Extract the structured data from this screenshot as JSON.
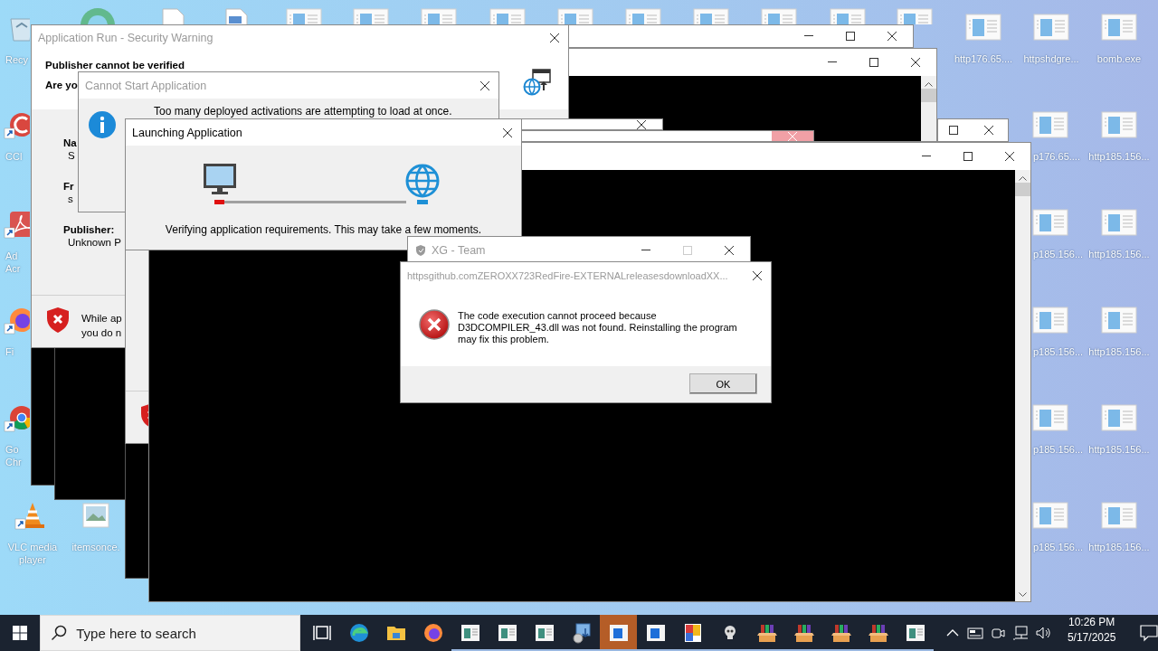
{
  "covered_icons": [
    {
      "kind": "app-round"
    },
    {
      "kind": "document"
    },
    {
      "kind": "document-blue"
    },
    {
      "kind": "window-file"
    },
    {
      "kind": "window-file"
    },
    {
      "kind": "window-file"
    },
    {
      "kind": "window-file"
    },
    {
      "kind": "window-file"
    },
    {
      "kind": "window-file"
    },
    {
      "kind": "window-file"
    },
    {
      "kind": "window-file"
    },
    {
      "kind": "window-file"
    },
    {
      "kind": "window-file"
    }
  ],
  "desktop_icons": [
    {
      "kind": "recycle-bin",
      "shortcut": false,
      "label": "Recy"
    },
    {
      "kind": "cleaner",
      "shortcut": true,
      "label": "CCl"
    },
    {
      "kind": "pdf-reader",
      "shortcut": true,
      "label": "Ad\nAcr"
    },
    {
      "kind": "firefox",
      "shortcut": true,
      "label": "Fi"
    },
    {
      "kind": "chrome",
      "shortcut": true,
      "label": "Go\nChr"
    },
    {
      "kind": "vlc",
      "shortcut": true,
      "label": "VLC media player"
    },
    {
      "kind": "image",
      "shortcut": false,
      "label": "itemsonce."
    },
    {
      "kind": "window-file",
      "shortcut": false,
      "label": "http176.65...."
    },
    {
      "kind": "window-file",
      "shortcut": false,
      "label": "httpshdgre..."
    },
    {
      "kind": "window-file",
      "shortcut": false,
      "label": "bomb.exe"
    },
    {
      "kind": "window-file",
      "shortcut": false,
      "label": "p176.65...."
    },
    {
      "kind": "window-file",
      "shortcut": false,
      "label": "http185.156..."
    },
    {
      "kind": "window-file",
      "shortcut": false,
      "label": "p185.156..."
    },
    {
      "kind": "window-file",
      "shortcut": false,
      "label": "http185.156..."
    },
    {
      "kind": "window-file",
      "shortcut": false,
      "label": "p185.156..."
    },
    {
      "kind": "window-file",
      "shortcut": false,
      "label": "http185.156..."
    },
    {
      "kind": "window-file",
      "shortcut": false,
      "label": "p185.156..."
    },
    {
      "kind": "window-file",
      "shortcut": false,
      "label": "http185.156..."
    },
    {
      "kind": "window-file",
      "shortcut": false,
      "label": "p185.156..."
    },
    {
      "kind": "window-file",
      "shortcut": false,
      "label": "http185.156..."
    }
  ],
  "windows": [
    {
      "kind": "bar",
      "buttons": [
        {
          "kind": "minimize",
          "disabled": false,
          "highlighted": false
        },
        {
          "kind": "maximize",
          "disabled": false,
          "highlighted": false
        },
        {
          "kind": "close",
          "disabled": false,
          "highlighted": false
        }
      ]
    },
    {
      "kind": "bar",
      "buttons": [
        {
          "kind": "maximize",
          "disabled": false,
          "highlighted": false
        },
        {
          "kind": "close",
          "disabled": false,
          "highlighted": false
        }
      ]
    },
    {
      "kind": "console",
      "buttons": [
        {
          "kind": "minimize",
          "disabled": false,
          "highlighted": false
        },
        {
          "kind": "maximize",
          "disabled": false,
          "highlighted": false
        },
        {
          "kind": "close",
          "disabled": false,
          "highlighted": false
        }
      ]
    },
    {
      "kind": "blank"
    },
    {
      "kind": "blank"
    },
    {
      "kind": "blank"
    },
    {
      "kind": "security-warning",
      "title": "Application Run - Security Warning",
      "active": false,
      "buttons": [
        {
          "kind": "close",
          "disabled": false,
          "highlighted": false
        }
      ],
      "heading": [
        "Publisher cannot be verified",
        "Are yo"
      ],
      "fields": [
        {
          "label": "Na",
          "value": "S"
        },
        {
          "label": "Fr",
          "value": "s"
        },
        {
          "label": "Publisher:",
          "value": "Unknown P"
        }
      ],
      "warning": [
        "While ap",
        "you do n"
      ]
    },
    {
      "kind": "warning-stub"
    },
    {
      "kind": "bar",
      "buttons": [
        {
          "kind": "close",
          "disabled": false,
          "highlighted": false
        }
      ]
    },
    {
      "kind": "bar",
      "buttons": [
        {
          "kind": "close",
          "disabled": false,
          "highlighted": true
        }
      ]
    },
    {
      "kind": "cannot-start",
      "title": "Cannot Start Application",
      "active": false,
      "buttons": [
        {
          "kind": "close",
          "disabled": false,
          "highlighted": false
        }
      ],
      "message": "Too many deployed activations are attempting to load at once."
    },
    {
      "kind": "console",
      "buttons": [
        {
          "kind": "minimize",
          "disabled": false,
          "highlighted": false
        },
        {
          "kind": "maximize",
          "disabled": false,
          "highlighted": false
        },
        {
          "kind": "close",
          "disabled": false,
          "highlighted": false
        }
      ]
    },
    {
      "kind": "launching",
      "title": "Launching Application",
      "active": true,
      "buttons": [
        {
          "kind": "close",
          "disabled": false,
          "highlighted": false
        }
      ],
      "message": "Verifying application requirements. This may take a few moments."
    },
    {
      "kind": "team",
      "title": "XG - Team",
      "active": false,
      "buttons": [
        {
          "kind": "minimize",
          "disabled": false,
          "highlighted": false
        },
        {
          "kind": "maximize",
          "disabled": true,
          "highlighted": false
        },
        {
          "kind": "close",
          "disabled": false,
          "highlighted": false
        }
      ]
    },
    {
      "kind": "error",
      "title": "httpsgithub.comZEROXX723RedFire-EXTERNALreleasesdownloadXX...",
      "active": false,
      "buttons": [
        {
          "kind": "close",
          "disabled": false,
          "highlighted": false
        }
      ],
      "message": "The code execution cannot proceed because D3DCOMPILER_43.dll was not found. Reinstalling the program may fix this problem.",
      "ok": "OK"
    }
  ],
  "taskbar": {
    "search": {
      "placeholder": "Type here to search"
    },
    "apps": [
      {
        "kind": "task-view",
        "running": false,
        "selected": false
      },
      {
        "kind": "edge",
        "running": false,
        "selected": false
      },
      {
        "kind": "explorer",
        "running": false,
        "selected": false
      },
      {
        "kind": "firefox",
        "running": false,
        "selected": false
      },
      {
        "kind": "window-green",
        "running": true,
        "selected": false
      },
      {
        "kind": "window-green",
        "running": true,
        "selected": false
      },
      {
        "kind": "window-green",
        "running": true,
        "selected": false
      },
      {
        "kind": "installer",
        "running": true,
        "selected": false
      },
      {
        "kind": "window-blue",
        "running": true,
        "selected": true
      },
      {
        "kind": "window-blue",
        "running": true,
        "selected": false
      },
      {
        "kind": "palette",
        "running": true,
        "selected": false
      },
      {
        "kind": "skull",
        "running": true,
        "selected": false
      },
      {
        "kind": "archive",
        "running": true,
        "selected": false
      },
      {
        "kind": "archive",
        "running": true,
        "selected": false
      },
      {
        "kind": "archive",
        "running": true,
        "selected": false
      },
      {
        "kind": "archive",
        "running": true,
        "selected": false
      },
      {
        "kind": "window-green",
        "running": true,
        "selected": false
      }
    ],
    "tray": [
      {
        "kind": "chevron"
      },
      {
        "kind": "keyboard"
      },
      {
        "kind": "camera"
      },
      {
        "kind": "network"
      },
      {
        "kind": "volume"
      }
    ],
    "clock": {
      "time": "10:26 PM",
      "date": "5/17/2025"
    }
  }
}
